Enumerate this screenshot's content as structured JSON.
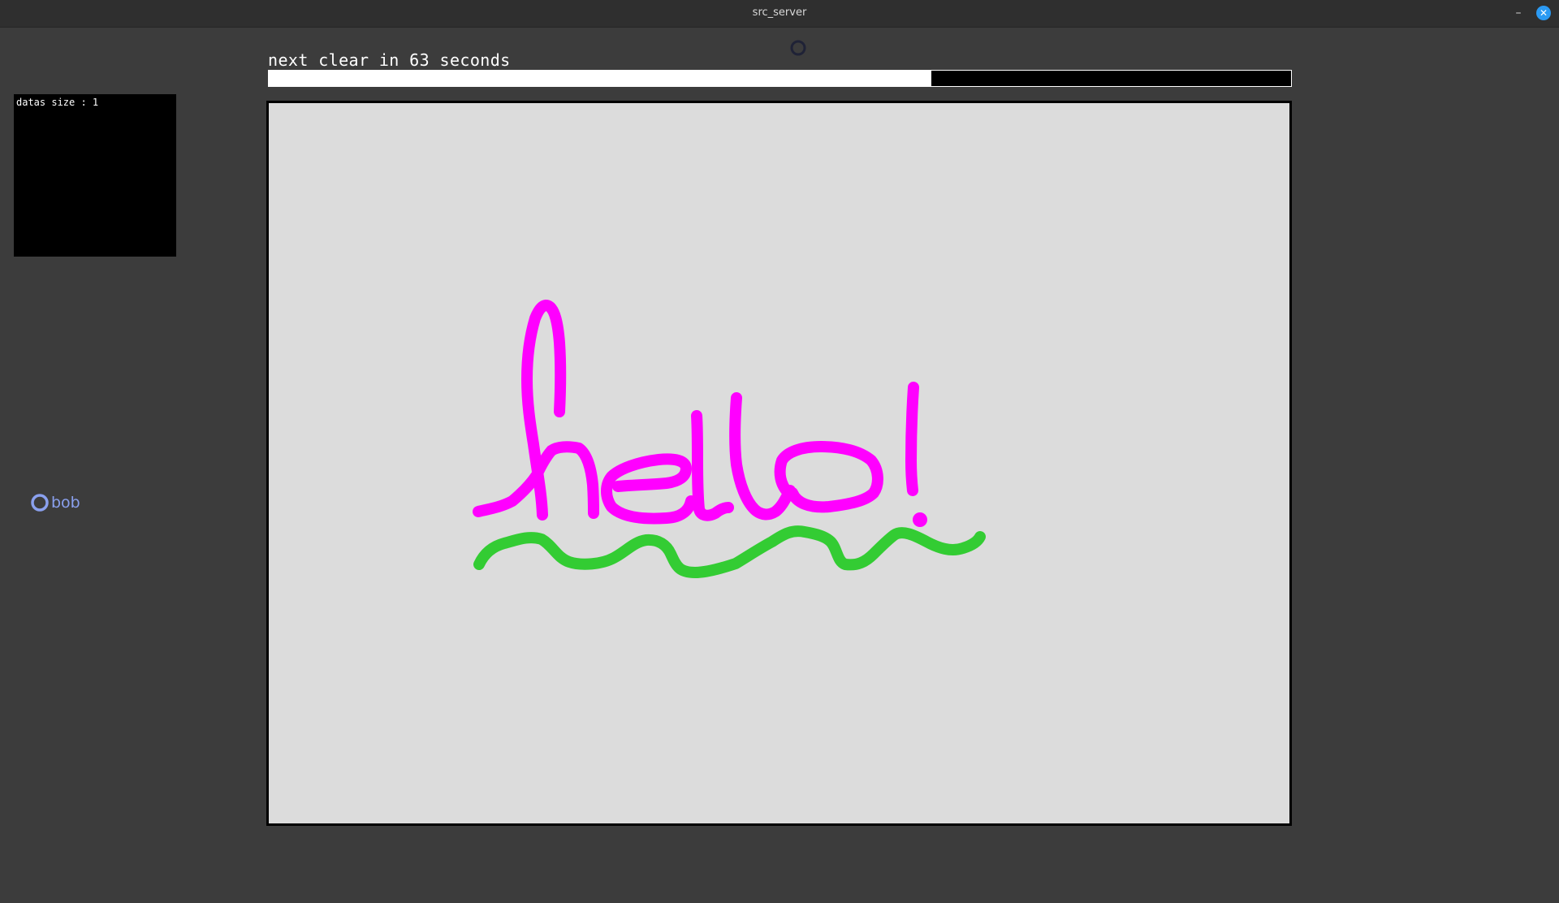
{
  "window": {
    "title": "src_server",
    "minimize_glyph": "–",
    "close_glyph": "✕"
  },
  "timer": {
    "label": "next clear in 63 seconds",
    "progress_fraction": 0.648
  },
  "info": {
    "datas_label": "datas size : 1"
  },
  "user": {
    "name": "bob",
    "cursor_color": "#8aa0ee"
  },
  "canvas": {
    "background": "#dcdcdc",
    "strokes": [
      {
        "name": "stroke-hello-h",
        "color": "#ff00ff"
      },
      {
        "name": "stroke-hello-h-tail",
        "color": "#ff00ff"
      },
      {
        "name": "stroke-hello-e",
        "color": "#ff00ff"
      },
      {
        "name": "stroke-hello-l1",
        "color": "#ff00ff"
      },
      {
        "name": "stroke-hello-l2",
        "color": "#ff00ff"
      },
      {
        "name": "stroke-hello-o",
        "color": "#ff00ff"
      },
      {
        "name": "stroke-hello-bang",
        "color": "#ff00ff"
      },
      {
        "name": "stroke-hello-dot",
        "color": "#ff00ff"
      },
      {
        "name": "stroke-wave",
        "color": "#33cc33"
      }
    ]
  },
  "colors": {
    "window_bg": "#3c3c3c",
    "titlebar_bg": "#2f2f2f",
    "accent": "#2b9af3"
  }
}
